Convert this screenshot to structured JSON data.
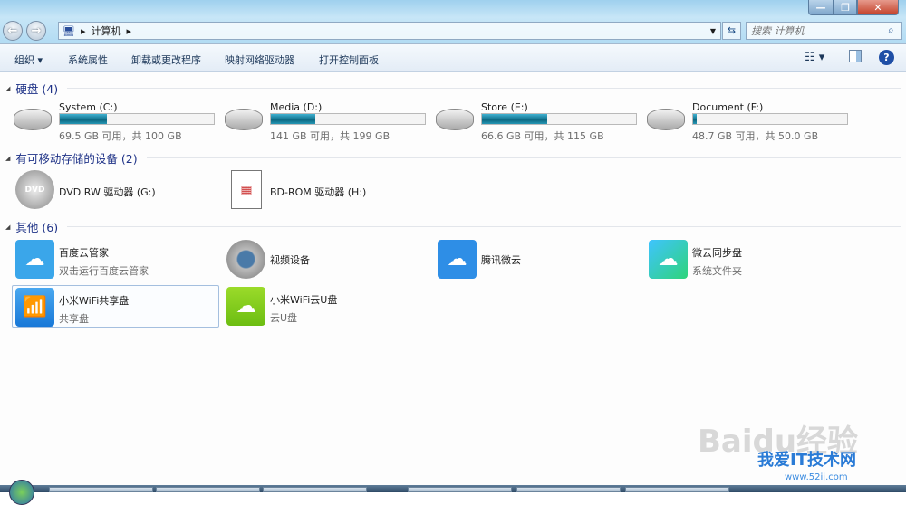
{
  "window": {
    "minimize": "—",
    "maximize": "❐",
    "close": "✕"
  },
  "nav": {
    "back": "←",
    "forward": "→"
  },
  "address": {
    "path": "计算机",
    "sep": "▸"
  },
  "search": {
    "placeholder": "搜索 计算机"
  },
  "toolbar": {
    "organize": "组织 ▾",
    "system_properties": "系统属性",
    "uninstall": "卸载或更改程序",
    "map_drive": "映射网络驱动器",
    "control_panel": "打开控制面板"
  },
  "groups": {
    "hdd": {
      "title": "硬盘 (4)",
      "drives": [
        {
          "name": "System (C:)",
          "free": "69.5 GB 可用，共 100 GB",
          "used_pct": 30.5
        },
        {
          "name": "Media (D:)",
          "free": "141 GB 可用，共 199 GB",
          "used_pct": 29.1
        },
        {
          "name": "Store (E:)",
          "free": "66.6 GB 可用，共 115 GB",
          "used_pct": 42.1
        },
        {
          "name": "Document (F:)",
          "free": "48.7 GB 可用，共 50.0 GB",
          "used_pct": 2.6
        }
      ]
    },
    "removable": {
      "title": "有可移动存储的设备 (2)",
      "items": [
        {
          "name": "DVD RW 驱动器 (G:)"
        },
        {
          "name": "BD-ROM 驱动器 (H:)"
        }
      ]
    },
    "other": {
      "title": "其他 (6)",
      "items": [
        {
          "name": "百度云管家",
          "sub": "双击运行百度云管家"
        },
        {
          "name": "视频设备"
        },
        {
          "name": "腾讯微云"
        },
        {
          "name": "微云同步盘",
          "sub": "系统文件夹"
        },
        {
          "name": "小米WiFi共享盘",
          "sub": "共享盘"
        },
        {
          "name": "小米WiFi云U盘",
          "sub": "云U盘"
        }
      ]
    }
  },
  "watermark": {
    "baidu": "Baidu经验",
    "site": "我爱IT技术网",
    "url": "www.52ij.com"
  }
}
